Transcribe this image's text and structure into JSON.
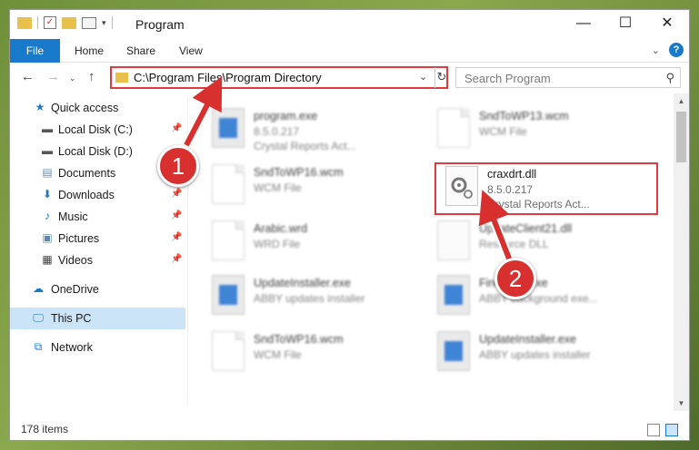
{
  "window": {
    "title": "Program",
    "controls": {
      "minimize": "—",
      "maximize": "☐",
      "close": "✕"
    }
  },
  "ribbon": {
    "tabs": [
      "File",
      "Home",
      "Share",
      "View"
    ],
    "help": "?"
  },
  "address": {
    "path": "C:\\Program Files\\Program Directory",
    "search_placeholder": "Search Program"
  },
  "sidebar": {
    "items": [
      {
        "label": "Quick access",
        "icon": "star-icon",
        "pinned": false
      },
      {
        "label": "Local Disk (C:)",
        "icon": "drive-icon",
        "pinned": true
      },
      {
        "label": "Local Disk (D:)",
        "icon": "drive-icon",
        "pinned": false
      },
      {
        "label": "Documents",
        "icon": "documents-icon",
        "pinned": true
      },
      {
        "label": "Downloads",
        "icon": "download-icon",
        "pinned": true
      },
      {
        "label": "Music",
        "icon": "music-icon",
        "pinned": true
      },
      {
        "label": "Pictures",
        "icon": "pictures-icon",
        "pinned": true
      },
      {
        "label": "Videos",
        "icon": "videos-icon",
        "pinned": true
      },
      {
        "label": "OneDrive",
        "icon": "cloud-icon",
        "pinned": false
      },
      {
        "label": "This PC",
        "icon": "computer-icon",
        "pinned": false,
        "selected": true
      },
      {
        "label": "Network",
        "icon": "network-icon",
        "pinned": false
      }
    ]
  },
  "files": [
    {
      "name": "program.exe",
      "line1": "8.5.0.217",
      "line2": "Crystal Reports Act...",
      "icon": "program-icon",
      "blurred": true
    },
    {
      "name": "SndToWP13.wcm",
      "line1": "WCM File",
      "line2": "",
      "icon": "document-icon",
      "blurred": true
    },
    {
      "name": "SndToWP16.wcm",
      "line1": "WCM File",
      "line2": "",
      "icon": "document-icon",
      "blurred": true
    },
    {
      "name": "craxdrt.dll",
      "line1": "8.5.0.217",
      "line2": "Crystal Reports Act...",
      "icon": "dll-gear-icon",
      "blurred": false
    },
    {
      "name": "Arabic.wrd",
      "line1": "WRD File",
      "line2": "",
      "icon": "document-icon",
      "blurred": true
    },
    {
      "name": "UpdateClient21.dll",
      "line1": "Resource DLL",
      "line2": "",
      "icon": "dll-gear-icon",
      "blurred": true
    },
    {
      "name": "UpdateInstaller.exe",
      "line1": "ABBY updates installer",
      "line2": "",
      "icon": "installer-icon",
      "blurred": true
    },
    {
      "name": "FineExec.exe",
      "line1": "ABBY background exe...",
      "line2": "",
      "icon": "installer-icon",
      "blurred": true
    },
    {
      "name": "SndToWP16.wcm",
      "line1": "WCM File",
      "line2": "",
      "icon": "document-icon",
      "blurred": true
    },
    {
      "name": "UpdateInstaller.exe",
      "line1": "ABBY updates installer",
      "line2": "",
      "icon": "installer-icon",
      "blurred": true
    }
  ],
  "status": {
    "count": "178 items"
  },
  "callouts": [
    "1",
    "2"
  ],
  "colors": {
    "accent": "#1979ca",
    "highlight": "#e23a3a",
    "callout": "#d8302e"
  }
}
